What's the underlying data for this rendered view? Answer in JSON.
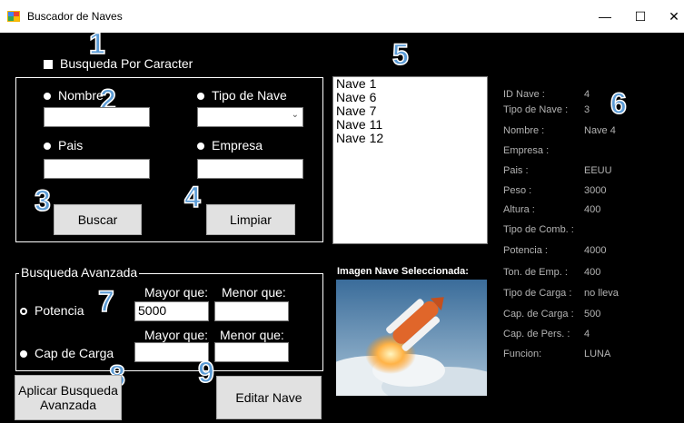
{
  "window": {
    "title": "Buscador de Naves",
    "minimize": "—",
    "maximize": "☐",
    "close": "✕"
  },
  "annotations": [
    "1",
    "2",
    "3",
    "4",
    "5",
    "6",
    "7",
    "8",
    "9"
  ],
  "search": {
    "checkbox_label": "Busqueda Por Caracter",
    "radio_nombre": "Nombre",
    "radio_tipo": "Tipo de Nave",
    "radio_pais": "Pais",
    "radio_empresa": "Empresa",
    "btn_buscar": "Buscar",
    "btn_limpiar": "Limpiar"
  },
  "results": {
    "items": [
      "Nave 1",
      "Nave 6",
      "Nave 7",
      "Nave 11",
      "Nave 12"
    ]
  },
  "advanced": {
    "title": "Busqueda Avanzada",
    "mayor_que": "Mayor que:",
    "menor_que": "Menor que:",
    "potencia": "Potencia",
    "potencia_mayor": "5000",
    "cap_carga": "Cap de Carga",
    "btn_aplicar": "Aplicar Busqueda Avanzada",
    "btn_editar": "Editar Nave"
  },
  "image": {
    "caption": "Imagen Nave Seleccionada:"
  },
  "details": [
    {
      "label": "ID Nave :",
      "value": "4"
    },
    {
      "label": "Tipo de Nave :",
      "value": "3"
    },
    {
      "label": "Nombre :",
      "value": "Nave 4"
    },
    {
      "label": "Empresa :",
      "value": ""
    },
    {
      "label": "Pais :",
      "value": "EEUU"
    },
    {
      "label": "Peso :",
      "value": "3000"
    },
    {
      "label": "Altura :",
      "value": "400"
    },
    {
      "label": "Tipo de Comb. :",
      "value": ""
    },
    {
      "label": "Potencia :",
      "value": "4000"
    },
    {
      "label": "Ton. de Emp. :",
      "value": "400"
    },
    {
      "label": "Tipo de Carga :",
      "value": "no lleva"
    },
    {
      "label": "Cap. de Carga :",
      "value": "500"
    },
    {
      "label": "Cap. de Pers. :",
      "value": "4"
    },
    {
      "label": "Funcion:",
      "value": "LUNA"
    }
  ]
}
